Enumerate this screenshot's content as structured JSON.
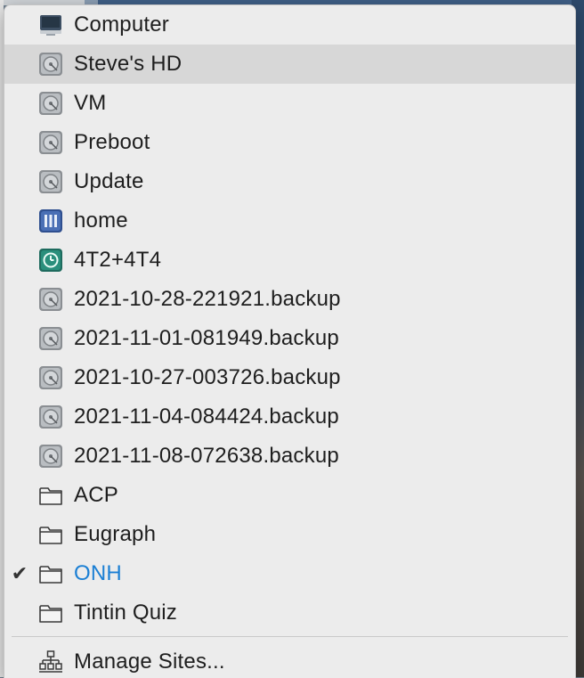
{
  "menu": {
    "items": [
      {
        "label": "Computer",
        "icon": "computer-icon"
      },
      {
        "label": "Steve's HD",
        "icon": "hard-drive-icon",
        "highlighted": true
      },
      {
        "label": "VM",
        "icon": "hard-drive-icon"
      },
      {
        "label": "Preboot",
        "icon": "hard-drive-icon"
      },
      {
        "label": "Update",
        "icon": "hard-drive-icon"
      },
      {
        "label": "home",
        "icon": "network-volume-icon"
      },
      {
        "label": "4T2+4T4",
        "icon": "time-machine-icon"
      },
      {
        "label": "2021-10-28-221921.backup",
        "icon": "hard-drive-icon"
      },
      {
        "label": "2021-11-01-081949.backup",
        "icon": "hard-drive-icon"
      },
      {
        "label": "2021-10-27-003726.backup",
        "icon": "hard-drive-icon"
      },
      {
        "label": "2021-11-04-084424.backup",
        "icon": "hard-drive-icon"
      },
      {
        "label": "2021-11-08-072638.backup",
        "icon": "hard-drive-icon"
      },
      {
        "label": "ACP",
        "icon": "folder-icon"
      },
      {
        "label": "Eugraph",
        "icon": "folder-icon"
      },
      {
        "label": "ONH",
        "icon": "folder-icon",
        "checked": true
      },
      {
        "label": "Tintin Quiz",
        "icon": "folder-icon"
      }
    ],
    "manage_sites": {
      "label": "Manage Sites...",
      "icon": "site-tree-icon"
    }
  },
  "colors": {
    "menu_background": "#ececec",
    "highlight": "#d7d7d7",
    "selected_text": "#1b7fd4",
    "text": "#1e1e1e"
  }
}
